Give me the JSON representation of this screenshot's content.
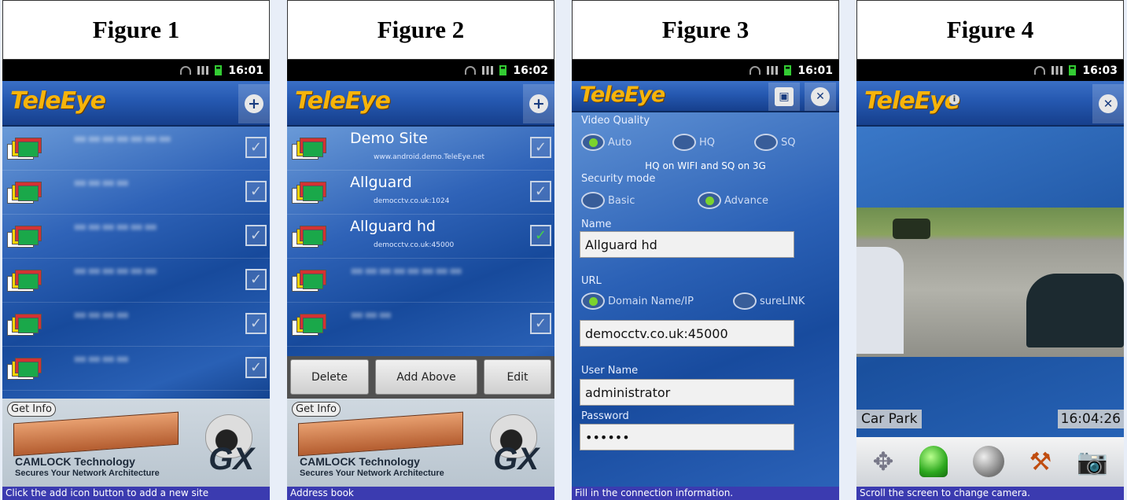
{
  "figures": [
    {
      "header": "Figure 1",
      "time": "16:01",
      "app_logo": "TeleEye",
      "status_line": "Click the add icon button to add a new site",
      "ad": {
        "get_info": "Get Info",
        "line1": "CAMLOCK Technology",
        "line2": "Secures Your Network Architecture",
        "brand": "GX"
      }
    },
    {
      "header": "Figure 2",
      "time": "16:02",
      "app_logo": "TeleEye",
      "sites": [
        {
          "name": "Demo Site",
          "url": "www.android.demo.TeleEye.net",
          "checked": false
        },
        {
          "name": "Allguard",
          "url": "democctv.co.uk:1024",
          "checked": false
        },
        {
          "name": "Allguard hd",
          "url": "democctv.co.uk:45000",
          "checked": true
        }
      ],
      "actions": {
        "delete": "Delete",
        "add_above": "Add Above",
        "edit": "Edit"
      },
      "status_line": "Address book",
      "ad": {
        "get_info": "Get Info",
        "line1": "CAMLOCK Technology",
        "line2": "Secures Your Network Architecture",
        "brand": "GX"
      }
    },
    {
      "header": "Figure 3",
      "time": "16:01",
      "app_logo": "TeleEye",
      "form": {
        "video_quality_label": "Video Quality",
        "vq_auto": "Auto",
        "vq_hq": "HQ",
        "vq_sq": "SQ",
        "vq_note": "HQ on WIFI and SQ on 3G",
        "security_mode_label": "Security mode",
        "sec_basic": "Basic",
        "sec_advance": "Advance",
        "name_label": "Name",
        "name_value": "Allguard hd",
        "url_label": "URL",
        "url_domain": "Domain Name/IP",
        "url_surelink": "sureLINK",
        "url_value": "democctv.co.uk:45000",
        "user_label": "User Name",
        "user_value": "administrator",
        "password_label": "Password",
        "password_value": "••••••"
      },
      "status_line": "Fill in the connection information."
    },
    {
      "header": "Figure 4",
      "time": "16:03",
      "app_logo": "TeleEye",
      "camera_name": "Car Park",
      "camera_time": "16:04:26",
      "status_line": "Scroll the screen to change camera."
    }
  ],
  "icons": [
    "wifi-icon",
    "signal-icon",
    "battery-icon",
    "add-icon",
    "save-icon",
    "close-icon",
    "info-icon",
    "ptz-move-icon",
    "alarm-light-icon",
    "globe-icon",
    "tools-icon",
    "snapshot-icon"
  ]
}
